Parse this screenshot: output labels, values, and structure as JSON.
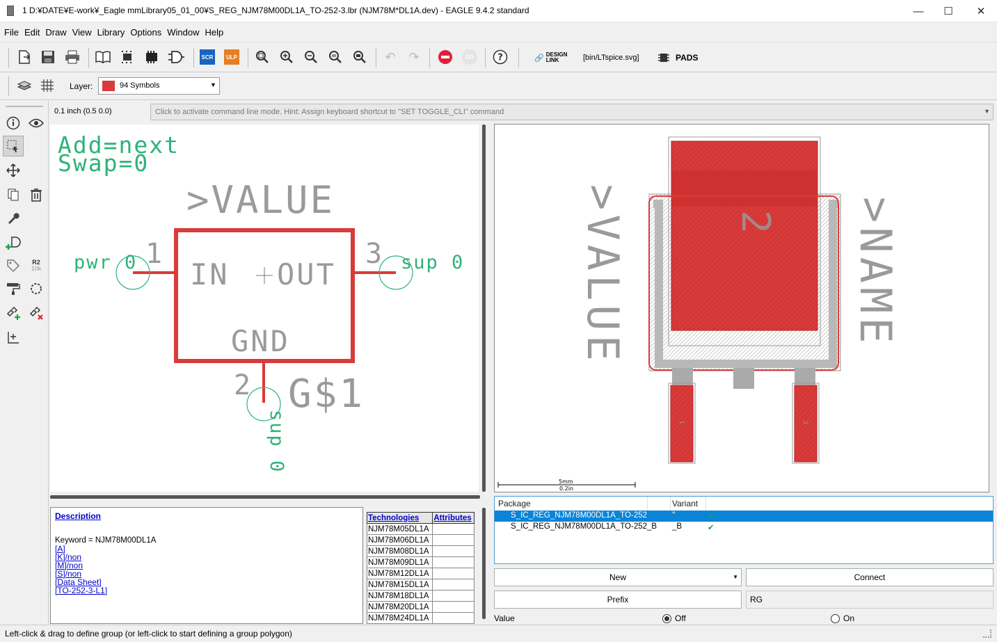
{
  "window": {
    "title": "1 D:¥DATE¥E-work¥_Eagle mmLibrary05_01_00¥S_REG_NJM78M00DL1A_TO-252-3.lbr (NJM78M*DL1A.dev) - EAGLE 9.4.2 standard",
    "minimize": "—",
    "maximize": "☐",
    "close": "✕"
  },
  "menu": [
    "File",
    "Edit",
    "Draw",
    "View",
    "Library",
    "Options",
    "Window",
    "Help"
  ],
  "toolbar": {
    "scr": "SCR",
    "ulp": "ULP",
    "design_link_1": "DESIGN",
    "design_link_2": "LINK",
    "ltspice": "[bin/LTspice.svg]",
    "pads": "PADS",
    "go": "GO"
  },
  "layer": {
    "label": "Layer:",
    "value": "94 Symbols",
    "color": "#d93b3b"
  },
  "coords": "0.1 inch (0.5 0.0)",
  "cmdline": "Click to activate command line mode. Hint: Assign keyboard shortcut to \"SET TOGGLE_CLI\" command",
  "symbol": {
    "add": "Add=next",
    "swap": "Swap=0",
    "value": ">VALUE",
    "pin_in": "IN",
    "pin_out": "OUT",
    "pin_gnd": "GND",
    "pin1_num": "1",
    "pin3_num": "3",
    "pin2_num": "2",
    "pin1_net": "pwr 0",
    "pin3_net": "sup 0",
    "pin2_net": "sup 0",
    "gate": "G$1"
  },
  "package": {
    "value": ">VALUE",
    "name": ">NAME",
    "pad2": "2",
    "pad1": "1",
    "pad3": "3",
    "scale_mm": "5mm",
    "scale_in": "0.2in"
  },
  "description": {
    "heading": "Description",
    "keyword": "Keyword = NJM78M00DL1A",
    "links": [
      "[A]",
      "[K]/non",
      "[M]/non",
      "[S]/non",
      "[Data Sheet]",
      "[TO-252-3-L1]"
    ]
  },
  "technologies": {
    "col1": "Technologies",
    "col2": "Attributes",
    "rows": [
      "NJM78M05DL1A",
      "NJM78M06DL1A",
      "NJM78M08DL1A",
      "NJM78M09DL1A",
      "NJM78M12DL1A",
      "NJM78M15DL1A",
      "NJM78M18DL1A",
      "NJM78M20DL1A",
      "NJM78M24DL1A"
    ]
  },
  "pkgtable": {
    "col_package": "Package",
    "col_variant": "Variant",
    "rows": [
      {
        "package": "S_IC_REG_NJM78M00DL1A_TO-252",
        "variant": "''",
        "check": "✔"
      },
      {
        "package": "S_IC_REG_NJM78M00DL1A_TO-252_B",
        "variant": "_B",
        "check": "✔"
      }
    ]
  },
  "buttons": {
    "new": "New",
    "connect": "Connect",
    "prefix": "Prefix",
    "prefix_value": "RG"
  },
  "value_option": {
    "label": "Value",
    "off": "Off",
    "on": "On"
  },
  "status": "Left-click & drag to define group (or left-click to start defining a group polygon)",
  "colors": {
    "symbol_red": "#d93b3b",
    "pin_green": "#2db37a",
    "text_gray": "#9a9a9a",
    "select_blue": "#0a84d6"
  }
}
